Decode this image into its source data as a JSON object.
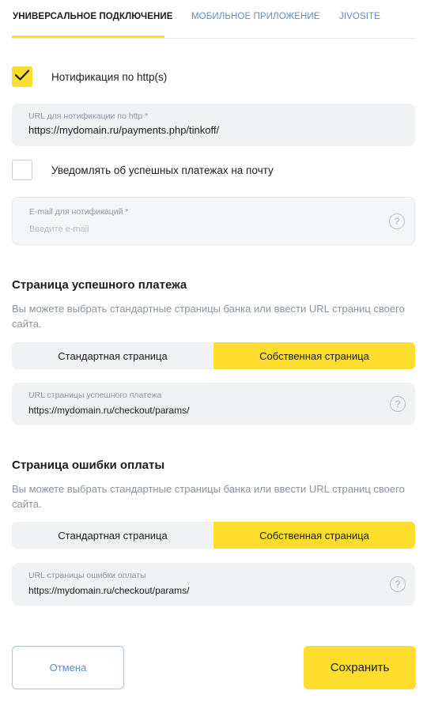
{
  "tabs": [
    {
      "label": "Универсальное подключение",
      "active": true
    },
    {
      "label": "Мобильное приложение",
      "active": false
    },
    {
      "label": "Jivosite",
      "active": false
    }
  ],
  "http_notification": {
    "label": "Нотификация по http(s)",
    "checked": true,
    "icon": "checkmark-icon"
  },
  "http_url": {
    "label": "URL для нотификации по http *",
    "value": "https://mydomain.ru/payments.php/tinkoff/"
  },
  "email_notification": {
    "label": "Уведомлять об успешных платежах на почту",
    "checked": false
  },
  "email_field": {
    "label": "E-mail для нотификаций *",
    "placeholder": "Введите e-mail",
    "help": "?"
  },
  "success_page": {
    "title": "Страница успешного платежа",
    "description": "Вы можете выбрать стандартные страницы банка или ввести URL страниц своего сайта.",
    "options": [
      "Стандартная страница",
      "Собственная страница"
    ],
    "selected": 1,
    "url_label": "URL страницы успешного платежа",
    "url_value": "https://mydomain.ru/checkout/params/",
    "help": "?"
  },
  "error_page": {
    "title": "Страница ошибки оплаты",
    "description": "Вы можете выбрать стандартные страницы банка или ввести URL страниц своего сайта.",
    "options": [
      "Стандартная страница",
      "Собственная страница"
    ],
    "selected": 1,
    "url_label": "URL страницы ошибки оплаты",
    "url_value": "https://mydomain.ru/checkout/params/",
    "help": "?"
  },
  "actions": {
    "cancel": "Отмена",
    "save": "Сохранить"
  },
  "colors": {
    "accent": "#ffdd2d",
    "link": "#5c8ec2",
    "field_bg": "#f1f2f4"
  }
}
